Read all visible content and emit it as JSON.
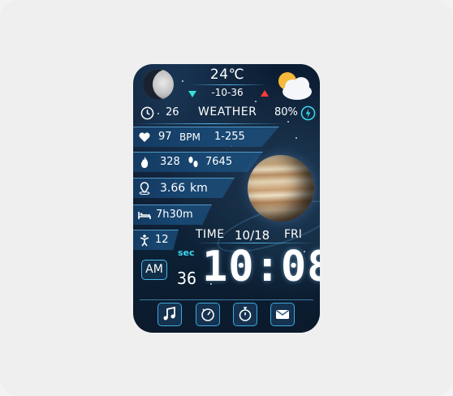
{
  "weather": {
    "temperature": "24℃",
    "range": "-10-36",
    "label": "WEATHER",
    "icon": "partly-cloudy-icon"
  },
  "top_row": {
    "clock_value": "26",
    "battery": "80%"
  },
  "stats": {
    "heart_rate": "97",
    "heart_unit": "BPM",
    "heart_range": "1-255",
    "calories": "328",
    "steps": "7645",
    "distance": "3.66",
    "distance_unit": "km",
    "sleep": "7h30m",
    "stand": "12"
  },
  "datetime": {
    "time_label": "TIME",
    "date": "10/18",
    "day": "FRI",
    "sec_label": "sec",
    "seconds": "36",
    "time": "10:08",
    "ampm": "AM"
  },
  "dock": {
    "items": [
      "music-icon",
      "timer-icon",
      "stopwatch-icon",
      "mail-icon"
    ]
  },
  "colors": {
    "accent": "#3ad7f0",
    "low_indicator": "#35e0d8",
    "high_indicator": "#ff3b3b"
  }
}
